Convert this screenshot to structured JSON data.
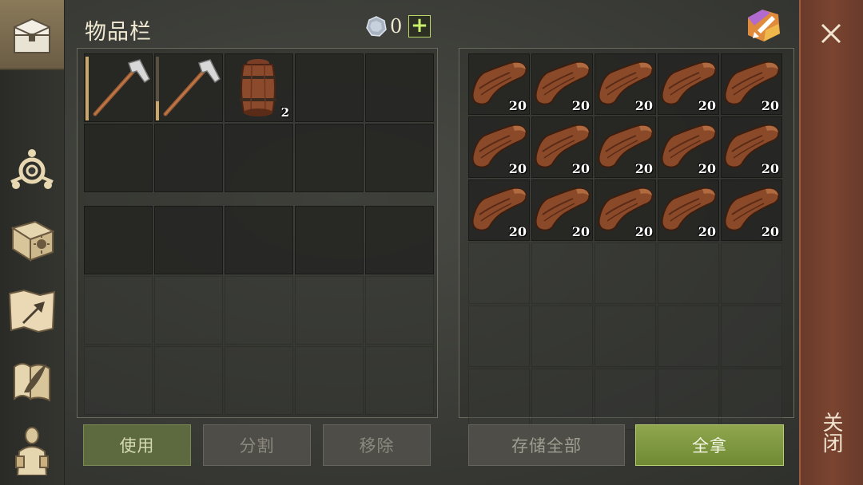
{
  "header": {
    "title": "物品栏",
    "currency_count": "0",
    "add_label": "+"
  },
  "sidebar": {
    "items": [
      {
        "id": "chest",
        "icon": "chest-icon"
      },
      {
        "id": "emblem",
        "icon": "emblem-icon"
      },
      {
        "id": "book",
        "icon": "sun-book-icon"
      },
      {
        "id": "map",
        "icon": "map-arrow-icon"
      },
      {
        "id": "scroll",
        "icon": "quill-scroll-icon"
      },
      {
        "id": "character",
        "icon": "character-icon"
      }
    ]
  },
  "inventory": {
    "items": [
      {
        "slot": 0,
        "icon": "pickaxe-icon",
        "durability": "high"
      },
      {
        "slot": 1,
        "icon": "pickaxe-icon",
        "durability": "low"
      },
      {
        "slot": 2,
        "icon": "barrel-icon",
        "count": "2"
      }
    ]
  },
  "container": {
    "item_icon": "leather-icon",
    "counts": [
      "20",
      "20",
      "20",
      "20",
      "20",
      "20",
      "20",
      "20",
      "20",
      "20",
      "20",
      "20",
      "20",
      "20",
      "20"
    ]
  },
  "buttons": {
    "use": "使用",
    "split": "分割",
    "remove": "移除",
    "store_all": "存储全部",
    "take_all": "全拿"
  },
  "close": {
    "label": "关闭"
  },
  "colors": {
    "accent_green": "#8fa64e",
    "close_red": "#7a4431",
    "plus_green": "#c9f06b"
  }
}
